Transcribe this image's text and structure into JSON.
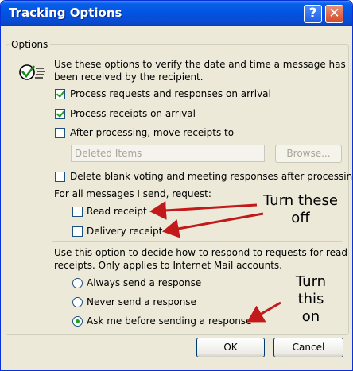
{
  "window": {
    "title": "Tracking Options",
    "help_glyph": "?",
    "close_glyph": "✕"
  },
  "group": {
    "label": "Options"
  },
  "intro_line1": "Use these options to verify the date and time a message has",
  "intro_line2": "been received by the recipient.",
  "options": {
    "process_requests": {
      "label": "Process requests and responses on arrival",
      "checked": true
    },
    "process_receipts": {
      "label": "Process receipts on arrival",
      "checked": true
    },
    "move_receipts": {
      "label": "After processing, move receipts to",
      "checked": false
    },
    "folder_value": "Deleted Items",
    "browse_label": "Browse...",
    "delete_blank": {
      "label": "Delete blank voting and meeting responses after processing",
      "checked": false
    }
  },
  "request_section": {
    "heading": "For all messages I send, request:",
    "read_receipt": {
      "label": "Read receipt",
      "checked": false
    },
    "delivery_receipt": {
      "label": "Delivery receipt",
      "checked": false
    }
  },
  "respond_section": {
    "line1": "Use this option to decide how to respond to requests for read",
    "line2": "receipts. Only applies to Internet Mail accounts.",
    "always": {
      "label": "Always send a response",
      "selected": false
    },
    "never": {
      "label": "Never send a response",
      "selected": false
    },
    "ask": {
      "label": "Ask me before sending a response",
      "selected": true
    }
  },
  "buttons": {
    "ok": "OK",
    "cancel": "Cancel"
  },
  "annotations": {
    "turn_off_line1": "Turn these",
    "turn_off_line2": "off",
    "turn_on_line1": "Turn",
    "turn_on_line2": "this",
    "turn_on_line3": "on"
  },
  "colors": {
    "arrow": "#c21a1a",
    "check": "#21a121",
    "titlebar": "#0054e3"
  },
  "icons": {
    "tracking": "tracking-check-icon"
  }
}
